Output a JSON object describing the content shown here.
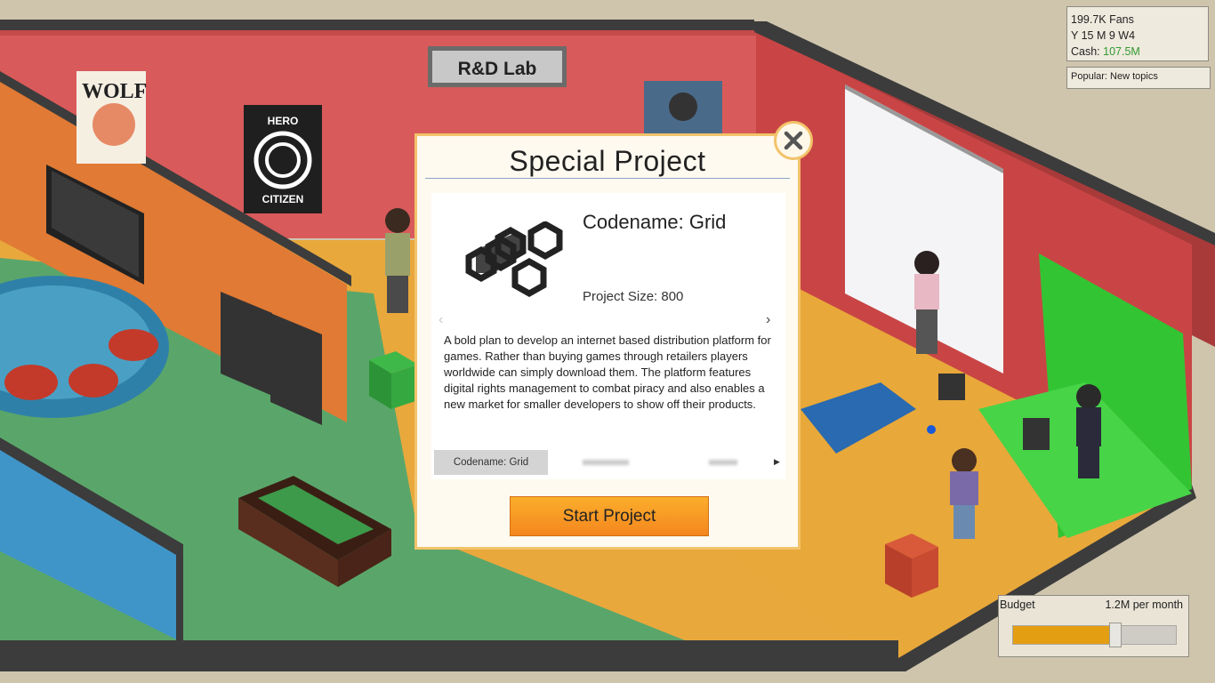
{
  "hud": {
    "fans": "199.7K Fans",
    "date": "Y 15 M 9 W4",
    "cash_label": "Cash: ",
    "cash_value": "107.5M",
    "cash_color": "#2f9a2f",
    "popular": "Popular: New topics"
  },
  "room": {
    "sign": "R&D Lab",
    "poster_wolf": "WOLF",
    "poster_hero_top": "HERO",
    "poster_hero_bottom": "CITIZEN"
  },
  "dialog": {
    "title": "Special Project",
    "codename": "Codename: Grid",
    "project_size": "Project Size: 800",
    "description": "A bold plan to develop an internet based distribution platform for games. Rather than buying games through retailers players worldwide can simply download them. The platform features digital rights management to combat piracy and also enables a new market for smaller developers to show off their products.",
    "prev_arrow": "‹",
    "next_arrow": "›",
    "tab_active": "Codename: Grid",
    "tab_scroll_arrow": "▶",
    "start_button": "Start Project",
    "close_icon": "close-icon",
    "accent": "#f2c36a",
    "button_color": "#f7931e"
  },
  "budget": {
    "label": "Budget",
    "value": "1.2M per month",
    "level": 0.6,
    "fill_color": "#e39e12"
  }
}
